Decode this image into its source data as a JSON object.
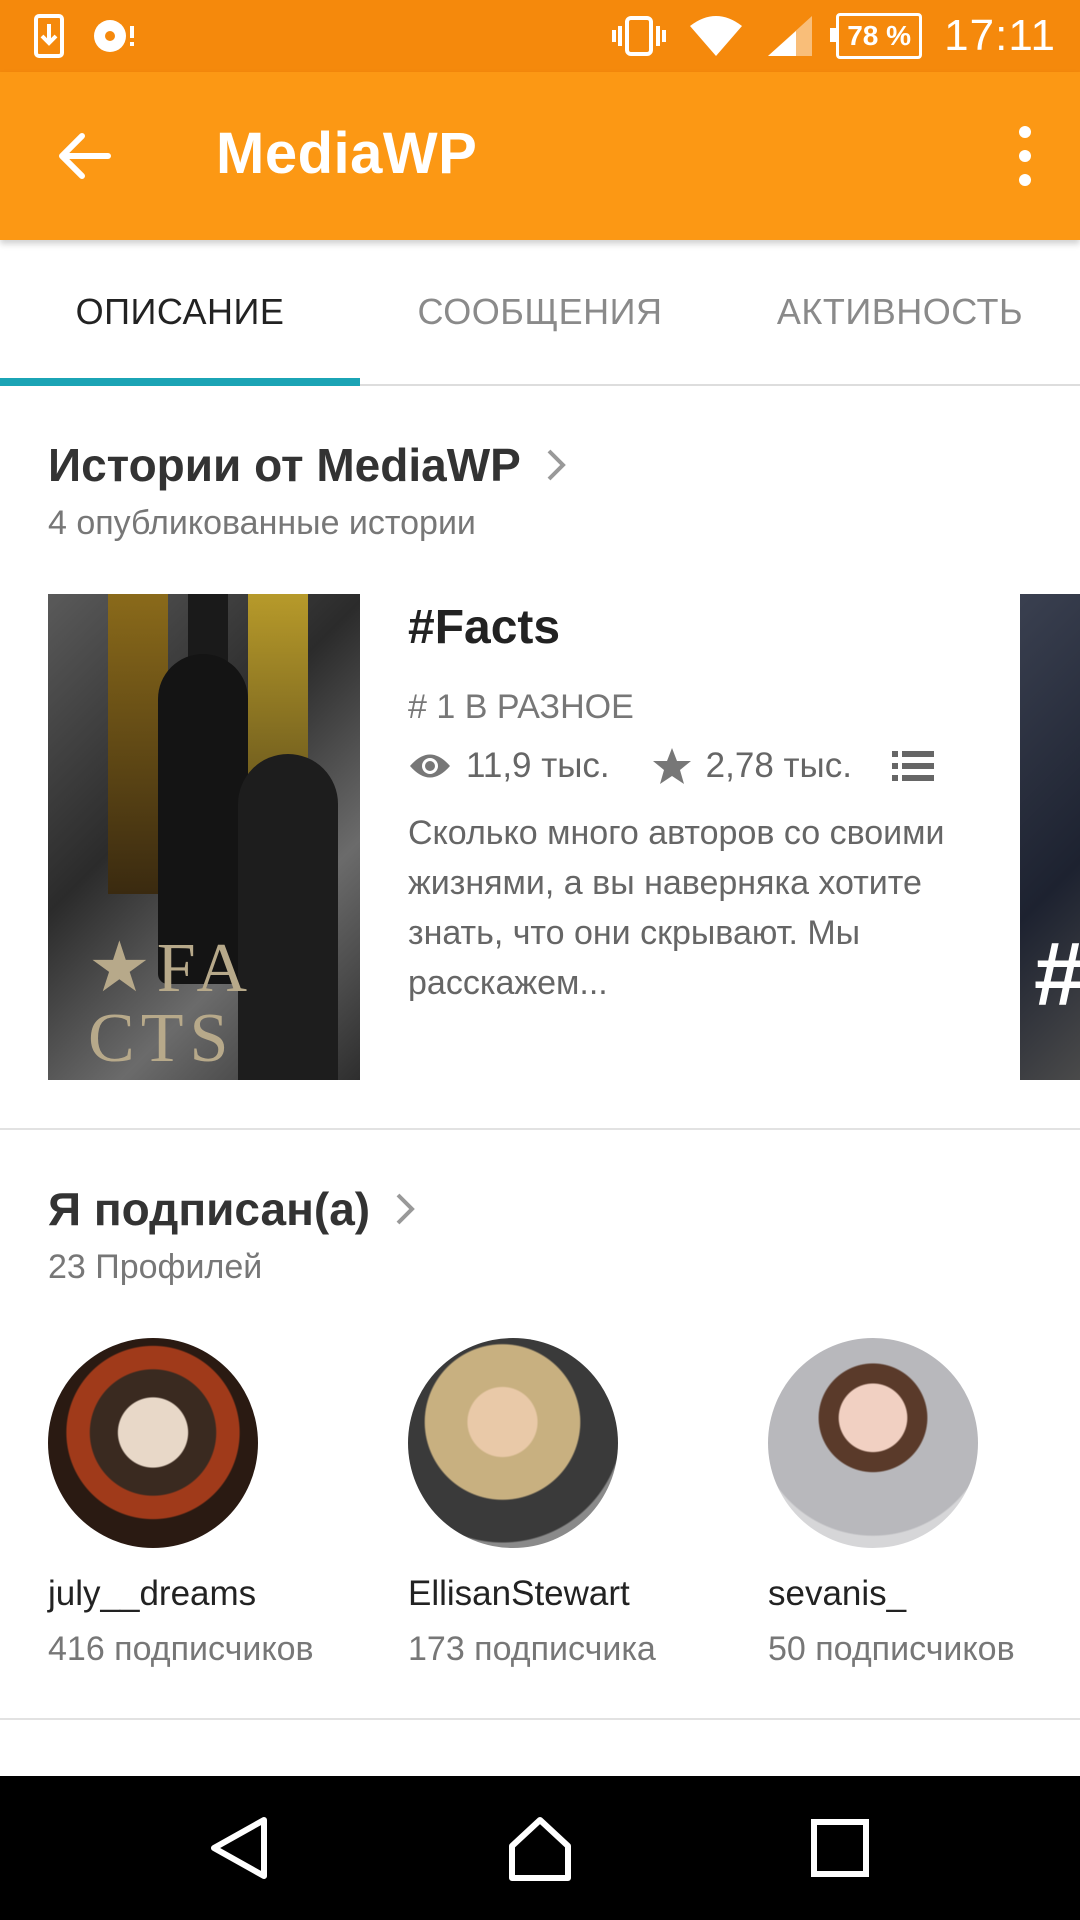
{
  "status_bar": {
    "time": "17:11",
    "battery": "78 %",
    "icons": [
      "usb-download-icon",
      "media-icon",
      "vibrate-icon",
      "wifi-icon",
      "signal-icon"
    ]
  },
  "app_bar": {
    "title": "MediaWP",
    "back_icon": "arrow-left-icon",
    "more_icon": "more-vert-icon",
    "color": "#fc9814"
  },
  "tabs": [
    {
      "label": "ОПИСАНИЕ",
      "active": true
    },
    {
      "label": "СООБЩЕНИЯ",
      "active": false
    },
    {
      "label": "АКТИВНОСТЬ",
      "active": false
    }
  ],
  "stories": {
    "title": "Истории от MediaWP",
    "subtitle": "4 опубликованные истории",
    "items": [
      {
        "cover_text": "★FA\nCTS",
        "title": "#Facts",
        "rank": "# 1 В РАЗНОЕ",
        "reads": "11,9 тыс.",
        "votes": "2,78 тыс.",
        "description": "Сколько много авторов со своими жизнями, а вы наверняка хотите знать, что они скрывают. Мы расскажем..."
      }
    ],
    "next_cover_text": "#"
  },
  "following": {
    "title": "Я подписан(а)",
    "subtitle": "23 Профилей",
    "profiles": [
      {
        "name": "july__dreams",
        "followers": "416 подписчиков"
      },
      {
        "name": "EllisanStewart",
        "followers": "173 подписчика"
      },
      {
        "name": "sevanis_",
        "followers": "50 подписчиков"
      }
    ]
  },
  "nav_bar": {
    "icons": [
      "back-triangle-icon",
      "home-icon",
      "recents-icon"
    ]
  }
}
